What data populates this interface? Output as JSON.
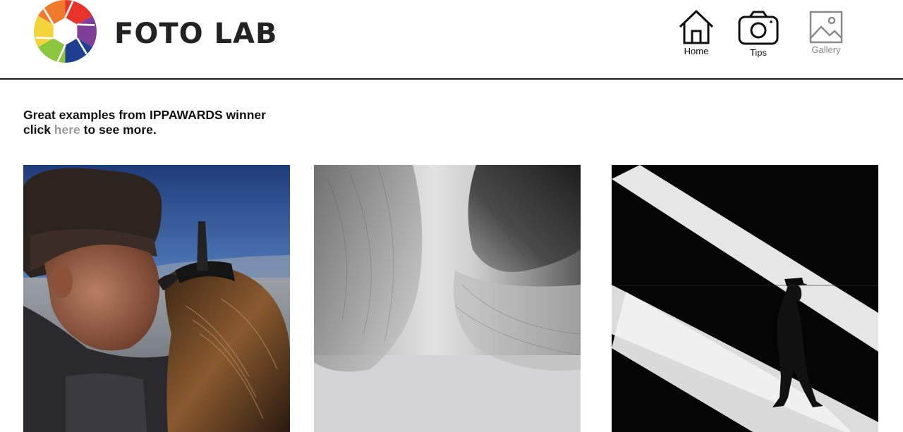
{
  "brand": {
    "name": "FOTO LAB",
    "colors": [
      "#e8332a",
      "#f07a2b",
      "#f2d43a",
      "#8cc63f",
      "#1e3f8f",
      "#7f3f98"
    ]
  },
  "nav": {
    "items": [
      {
        "label": "Home",
        "icon": "home-icon"
      },
      {
        "label": "Tips",
        "icon": "camera-icon"
      },
      {
        "label": "Gallery",
        "icon": "image-icon"
      }
    ]
  },
  "intro": {
    "line1": "Great examples from IPPAWARDS winner",
    "prefix": "click ",
    "link": "here",
    "suffix": " to see more."
  },
  "gallery": {
    "photos": [
      {
        "subject": "falconer-with-eagle"
      },
      {
        "subject": "abstract-grey-texture"
      },
      {
        "subject": "man-walking-in-light-beams"
      }
    ]
  }
}
